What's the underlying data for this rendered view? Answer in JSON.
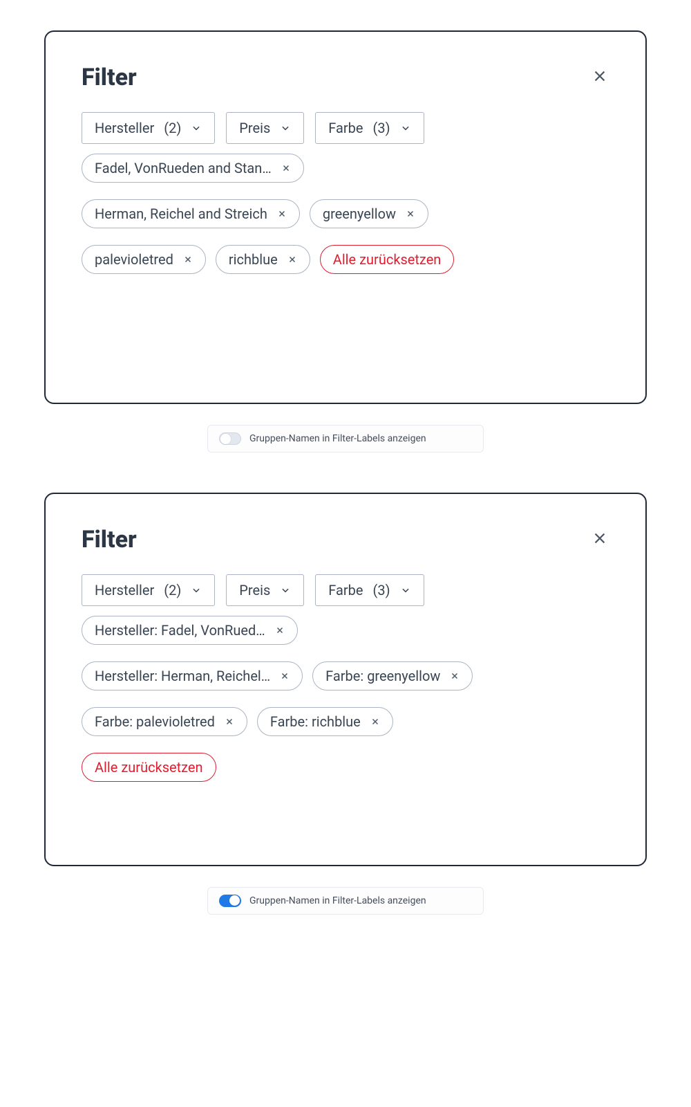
{
  "panel1": {
    "title": "Filter",
    "categories": [
      {
        "label": "Hersteller",
        "count": "(2)"
      },
      {
        "label": "Preis"
      },
      {
        "label": "Farbe",
        "count": "(3)"
      }
    ],
    "chips": [
      "Fadel, VonRueden and Stan…",
      "Herman, Reichel and Streich",
      "greenyellow",
      "palevioletred",
      "richblue"
    ],
    "reset": "Alle zurücksetzen"
  },
  "toggle1": {
    "on": false,
    "label": "Gruppen-Namen in Filter-Labels anzeigen"
  },
  "panel2": {
    "title": "Filter",
    "categories": [
      {
        "label": "Hersteller",
        "count": "(2)"
      },
      {
        "label": "Preis"
      },
      {
        "label": "Farbe",
        "count": "(3)"
      }
    ],
    "chips": [
      "Hersteller: Fadel, VonRued…",
      "Hersteller: Herman, Reichel…",
      "Farbe: greenyellow",
      "Farbe: palevioletred",
      "Farbe: richblue"
    ],
    "reset": "Alle zurücksetzen"
  },
  "toggle2": {
    "on": true,
    "label": "Gruppen-Namen in Filter-Labels anzeigen"
  }
}
